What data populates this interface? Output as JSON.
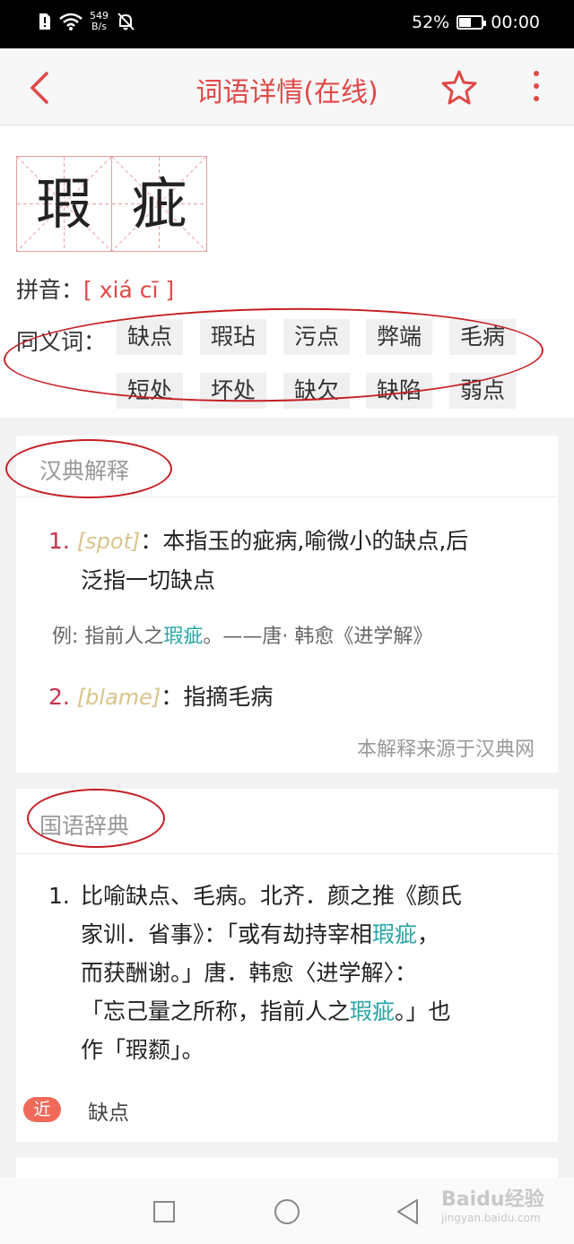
{
  "status_bar": {
    "net_speed_value": "549",
    "net_speed_unit": "B/s",
    "battery": "52%",
    "battery_level": 0.52,
    "time": "00:00"
  },
  "header": {
    "title": "词语详情(在线)",
    "back_icon": "chevron-left-icon",
    "star_icon": "star-outline-icon",
    "more_icon": "vertical-dots-icon",
    "accent_color": "#e04848"
  },
  "word": {
    "chars": [
      "瑕",
      "疵"
    ],
    "pinyin_label": "拼音：",
    "pinyin": "[ xiá cī ]",
    "synonyms_label": "同义词：",
    "synonyms": [
      "缺点",
      "瑕玷",
      "污点",
      "弊端",
      "毛病",
      "短处",
      "坏处",
      "缺欠",
      "缺陷",
      "弱点"
    ]
  },
  "handian": {
    "title": "汉典解释",
    "definitions": [
      {
        "num": "1.",
        "tag": "[spot]",
        "colon": "：",
        "line1": "本指玉的疵病,喻微小的缺点,后",
        "line2": "泛指一切缺点"
      },
      {
        "num": "2.",
        "tag": "[blame]",
        "colon": "：",
        "line1": "指摘毛病"
      }
    ],
    "example_prefix": "例: 指前人之",
    "example_word": "瑕疵",
    "example_suffix": "。——唐· 韩愈《进学解》",
    "source": "本解释来源于汉典网"
  },
  "guoyu": {
    "title": "国语辞典",
    "num": "1.",
    "l1": "比喻缺点、毛病。北齐．颜之推《颜氏",
    "l2a": "家训．省事》：「或有劫持宰相",
    "l2b": "瑕疵",
    "l2c": "，",
    "l3": "而获酬谢。」唐．韩愈〈进学解〉：",
    "l4a": "「忘己量之所称，指前人之",
    "l4b": "瑕疵",
    "l4c": "。」也",
    "l5": "作「瑕颣」。",
    "near_label": "近",
    "near_word": "缺点"
  },
  "watermark": {
    "logo": "Baidu经验",
    "url": "jingyan.baidu.com"
  },
  "colors": {
    "highlight": "#2aa5a5",
    "annotation_red": "#c51e23",
    "near_badge": "#f06a5a"
  }
}
